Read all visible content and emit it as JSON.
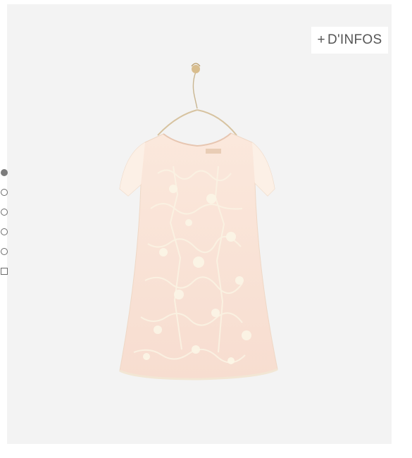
{
  "info_button": {
    "plus": "+",
    "label": "D'INFOS"
  },
  "gallery": {
    "items": [
      {
        "kind": "dot",
        "active": true
      },
      {
        "kind": "dot",
        "active": false
      },
      {
        "kind": "dot",
        "active": false
      },
      {
        "kind": "dot",
        "active": false
      },
      {
        "kind": "dot",
        "active": false
      },
      {
        "kind": "video-square",
        "active": false
      }
    ]
  },
  "colors": {
    "background": "#f3f3f3",
    "dress": "#f8e4d8",
    "lace": "#fbf3e3",
    "hanger": "#d8bd8e",
    "nav_active": "#7c7c7c"
  }
}
